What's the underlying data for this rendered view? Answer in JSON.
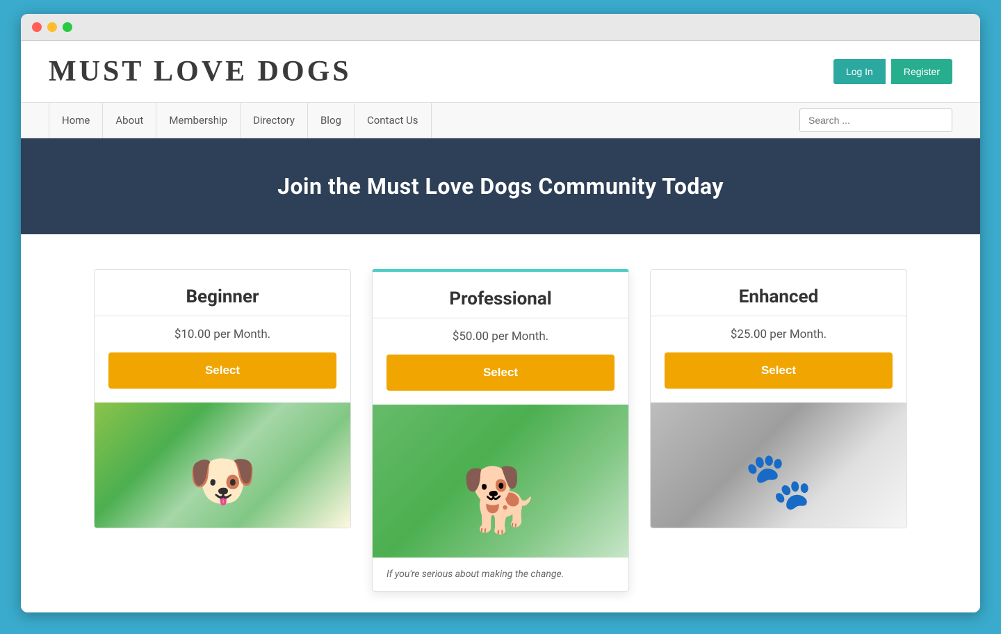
{
  "browser": {
    "dots": [
      "red",
      "yellow",
      "green"
    ]
  },
  "header": {
    "logo": "MUST LOVE DOGS",
    "login_label": "Log In",
    "register_label": "Register"
  },
  "nav": {
    "items": [
      {
        "label": "Home",
        "id": "home"
      },
      {
        "label": "About",
        "id": "about"
      },
      {
        "label": "Membership",
        "id": "membership"
      },
      {
        "label": "Directory",
        "id": "directory"
      },
      {
        "label": "Blog",
        "id": "blog"
      },
      {
        "label": "Contact Us",
        "id": "contact"
      }
    ],
    "search_placeholder": "Search ..."
  },
  "hero": {
    "title": "Join the Must Love Dogs Community Today"
  },
  "plans": [
    {
      "id": "beginner",
      "name": "Beginner",
      "price": "$10.00 per Month.",
      "select_label": "Select",
      "featured": false,
      "description": ""
    },
    {
      "id": "professional",
      "name": "Professional",
      "price": "$50.00 per Month.",
      "select_label": "Select",
      "featured": true,
      "description": "If you're serious about making the change."
    },
    {
      "id": "enhanced",
      "name": "Enhanced",
      "price": "$25.00 per Month.",
      "select_label": "Select",
      "featured": false,
      "description": ""
    }
  ]
}
